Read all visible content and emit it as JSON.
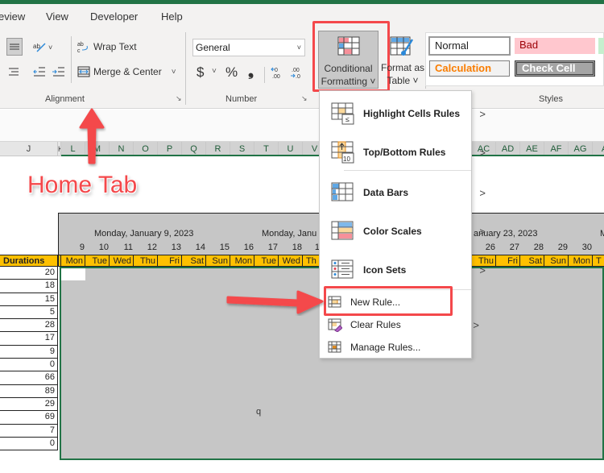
{
  "menubar": {
    "items": [
      "eview",
      "View",
      "Developer",
      "Help"
    ]
  },
  "ribbon": {
    "alignment": {
      "wrap_text": "Wrap Text",
      "merge_center": "Merge & Center",
      "group_label": "Alignment"
    },
    "number": {
      "format_value": "General",
      "currency": "$",
      "percent": "%",
      "comma": "9",
      "increase_decimal": "←.0 .00",
      "decrease_decimal": ".00 →.0",
      "group_label": "Number"
    },
    "conditional_formatting": {
      "line1": "Conditional",
      "line2": "Formatting ˅"
    },
    "format_as_table": {
      "line1": "Format as",
      "line2": "Table ˅"
    },
    "styles": {
      "normal": "Normal",
      "bad": "Bad",
      "calculation": "Calculation",
      "check_cell": "Check Cell",
      "group_label": "Styles"
    }
  },
  "column_headers": [
    "J",
    "K",
    "L",
    "M",
    "N",
    "O",
    "P",
    "Q",
    "R",
    "S",
    "T",
    "U",
    "V",
    "AC",
    "AD",
    "AE",
    "AF",
    "AG",
    "A"
  ],
  "calendar": {
    "week_labels": [
      "Monday, January 9, 2023",
      "Monday, Janu",
      "anuary 23, 2023",
      "M"
    ],
    "day_numbers_left": [
      "9",
      "10",
      "11",
      "12",
      "13",
      "14",
      "15",
      "16",
      "17",
      "18",
      "1"
    ],
    "day_numbers_right": [
      "26",
      "27",
      "28",
      "29",
      "30"
    ],
    "day_names_left": [
      "Mon",
      "Tue",
      "Wed",
      "Thu",
      "Fri",
      "Sat",
      "Sun",
      "Mon",
      "Tue",
      "Wed",
      "Th"
    ],
    "day_names_right": [
      "Thu",
      "Fri",
      "Sat",
      "Sun",
      "Mon",
      "T"
    ]
  },
  "durations": {
    "header": "Durations",
    "values": [
      "20",
      "18",
      "15",
      "5",
      "28",
      "17",
      "9",
      "0",
      "66",
      "89",
      "29",
      "69",
      "7",
      "0"
    ]
  },
  "cell_text": "q",
  "dropdown": {
    "items": [
      {
        "label": "Highlight Cells Rules",
        "has_submenu": true
      },
      {
        "label": "Top/Bottom Rules",
        "has_submenu": true
      },
      {
        "label": "Data Bars",
        "has_submenu": true
      },
      {
        "label": "Color Scales",
        "has_submenu": true
      },
      {
        "label": "Icon Sets",
        "has_submenu": true
      },
      {
        "label": "New Rule...",
        "has_submenu": false
      },
      {
        "label": "Clear Rules",
        "has_submenu": true
      },
      {
        "label": "Manage Rules...",
        "has_submenu": false
      }
    ],
    "chevron": ">"
  },
  "annotation": {
    "home_tab": "Home Tab"
  },
  "colors": {
    "excel_green": "#217346",
    "highlight_red": "#f4484b",
    "day_header_yellow": "#ffc000",
    "calendar_gray": "#c6c6c6"
  }
}
